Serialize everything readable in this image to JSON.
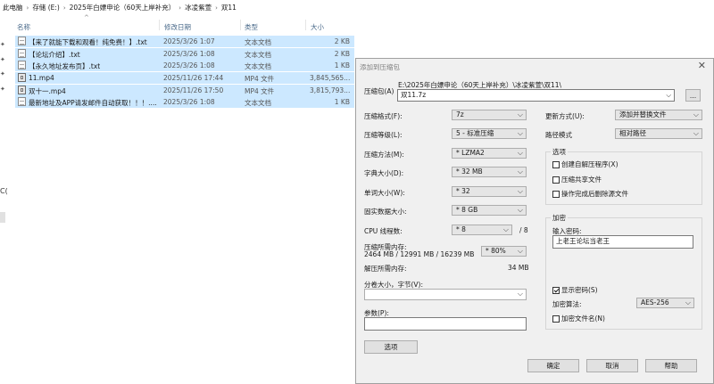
{
  "breadcrumb": [
    "此电脑",
    "存储 (E:)",
    "2025年白嫖申论（60天上岸补充）",
    "冰凌紫萱",
    "双11"
  ],
  "breadcrumb_sep": "›",
  "sort_caret": "^",
  "columns": {
    "name": "名称",
    "date": "修改日期",
    "type": "类型",
    "size": "大小"
  },
  "files": [
    {
      "name": "【来了就能下载和观看！纯免费！】.txt",
      "date": "2025/3/26 1:07",
      "type": "文本文档",
      "size": "2 KB",
      "icon": "text-file-icon"
    },
    {
      "name": "【论坛介绍】.txt",
      "date": "2025/3/26 1:08",
      "type": "文本文档",
      "size": "2 KB",
      "icon": "text-file-icon"
    },
    {
      "name": "【永久地址发布页】.txt",
      "date": "2025/3/26 1:08",
      "type": "文本文档",
      "size": "1 KB",
      "icon": "text-file-icon"
    },
    {
      "name": "11.mp4",
      "date": "2025/11/26 17:44",
      "type": "MP4 文件",
      "size": "3,845,565...",
      "icon": "video-file-icon"
    },
    {
      "name": "双十一.mp4",
      "date": "2025/11/26 17:50",
      "type": "MP4 文件",
      "size": "3,815,793...",
      "icon": "video-file-icon"
    },
    {
      "name": "最新地址及APP请发邮件自动获取！！！....",
      "date": "2025/3/26 1:08",
      "type": "文本文档",
      "size": "1 KB",
      "icon": "text-file-icon"
    }
  ],
  "pin_glyph": "✦",
  "left_edge_glyph": "C(",
  "dialog": {
    "title": "添加到压缩包",
    "close": "✕",
    "archive_label": "压缩包(A)",
    "archive_path": "E:\\2025年白嫖申论（60天上岸补充）\\冰凌紫萱\\双11\\",
    "archive_name": "双11.7z",
    "browse": "...",
    "format_label": "压缩格式(F):",
    "format_value": "7z",
    "level_label": "压缩等级(L):",
    "level_value": "5 - 标准压缩",
    "method_label": "压缩方法(M):",
    "method_value": "* LZMA2",
    "dict_label": "字典大小(D):",
    "dict_value": "* 32 MB",
    "word_label": "单词大小(W):",
    "word_value": "* 32",
    "solid_label": "固实数据大小:",
    "solid_value": "* 8 GB",
    "cpu_label": "CPU 线程数:",
    "cpu_value": "* 8",
    "cpu_total": "/ 8",
    "mem_label": "压缩所需内存:",
    "mem_detail": "2464 MB / 12991 MB / 16239 MB",
    "mem_percent": "* 80%",
    "decomp_label": "解压所需内存:",
    "decomp_value": "34 MB",
    "split_label": "分卷大小，字节(V):",
    "split_value": "",
    "params_label": "参数(P):",
    "params_value": "",
    "options_button": "选项",
    "update_label": "更新方式(U):",
    "update_value": "添加并替换文件",
    "path_mode_label": "路径模式",
    "path_mode_value": "相对路径",
    "options_group": "选项",
    "opt_sfx": "创建自解压程序(X)",
    "opt_shared": "压缩共享文件",
    "opt_delete": "操作完成后删除源文件",
    "enc_group": "加密",
    "password_label": "输入密码:",
    "password_value": "上老王论坛当老王",
    "show_password": "显示密码(S)",
    "enc_method_label": "加密算法:",
    "enc_method_value": "AES-256",
    "enc_names": "加密文件名(N)",
    "ok": "确定",
    "cancel": "取消",
    "help": "帮助",
    "arrow": "⌵"
  }
}
